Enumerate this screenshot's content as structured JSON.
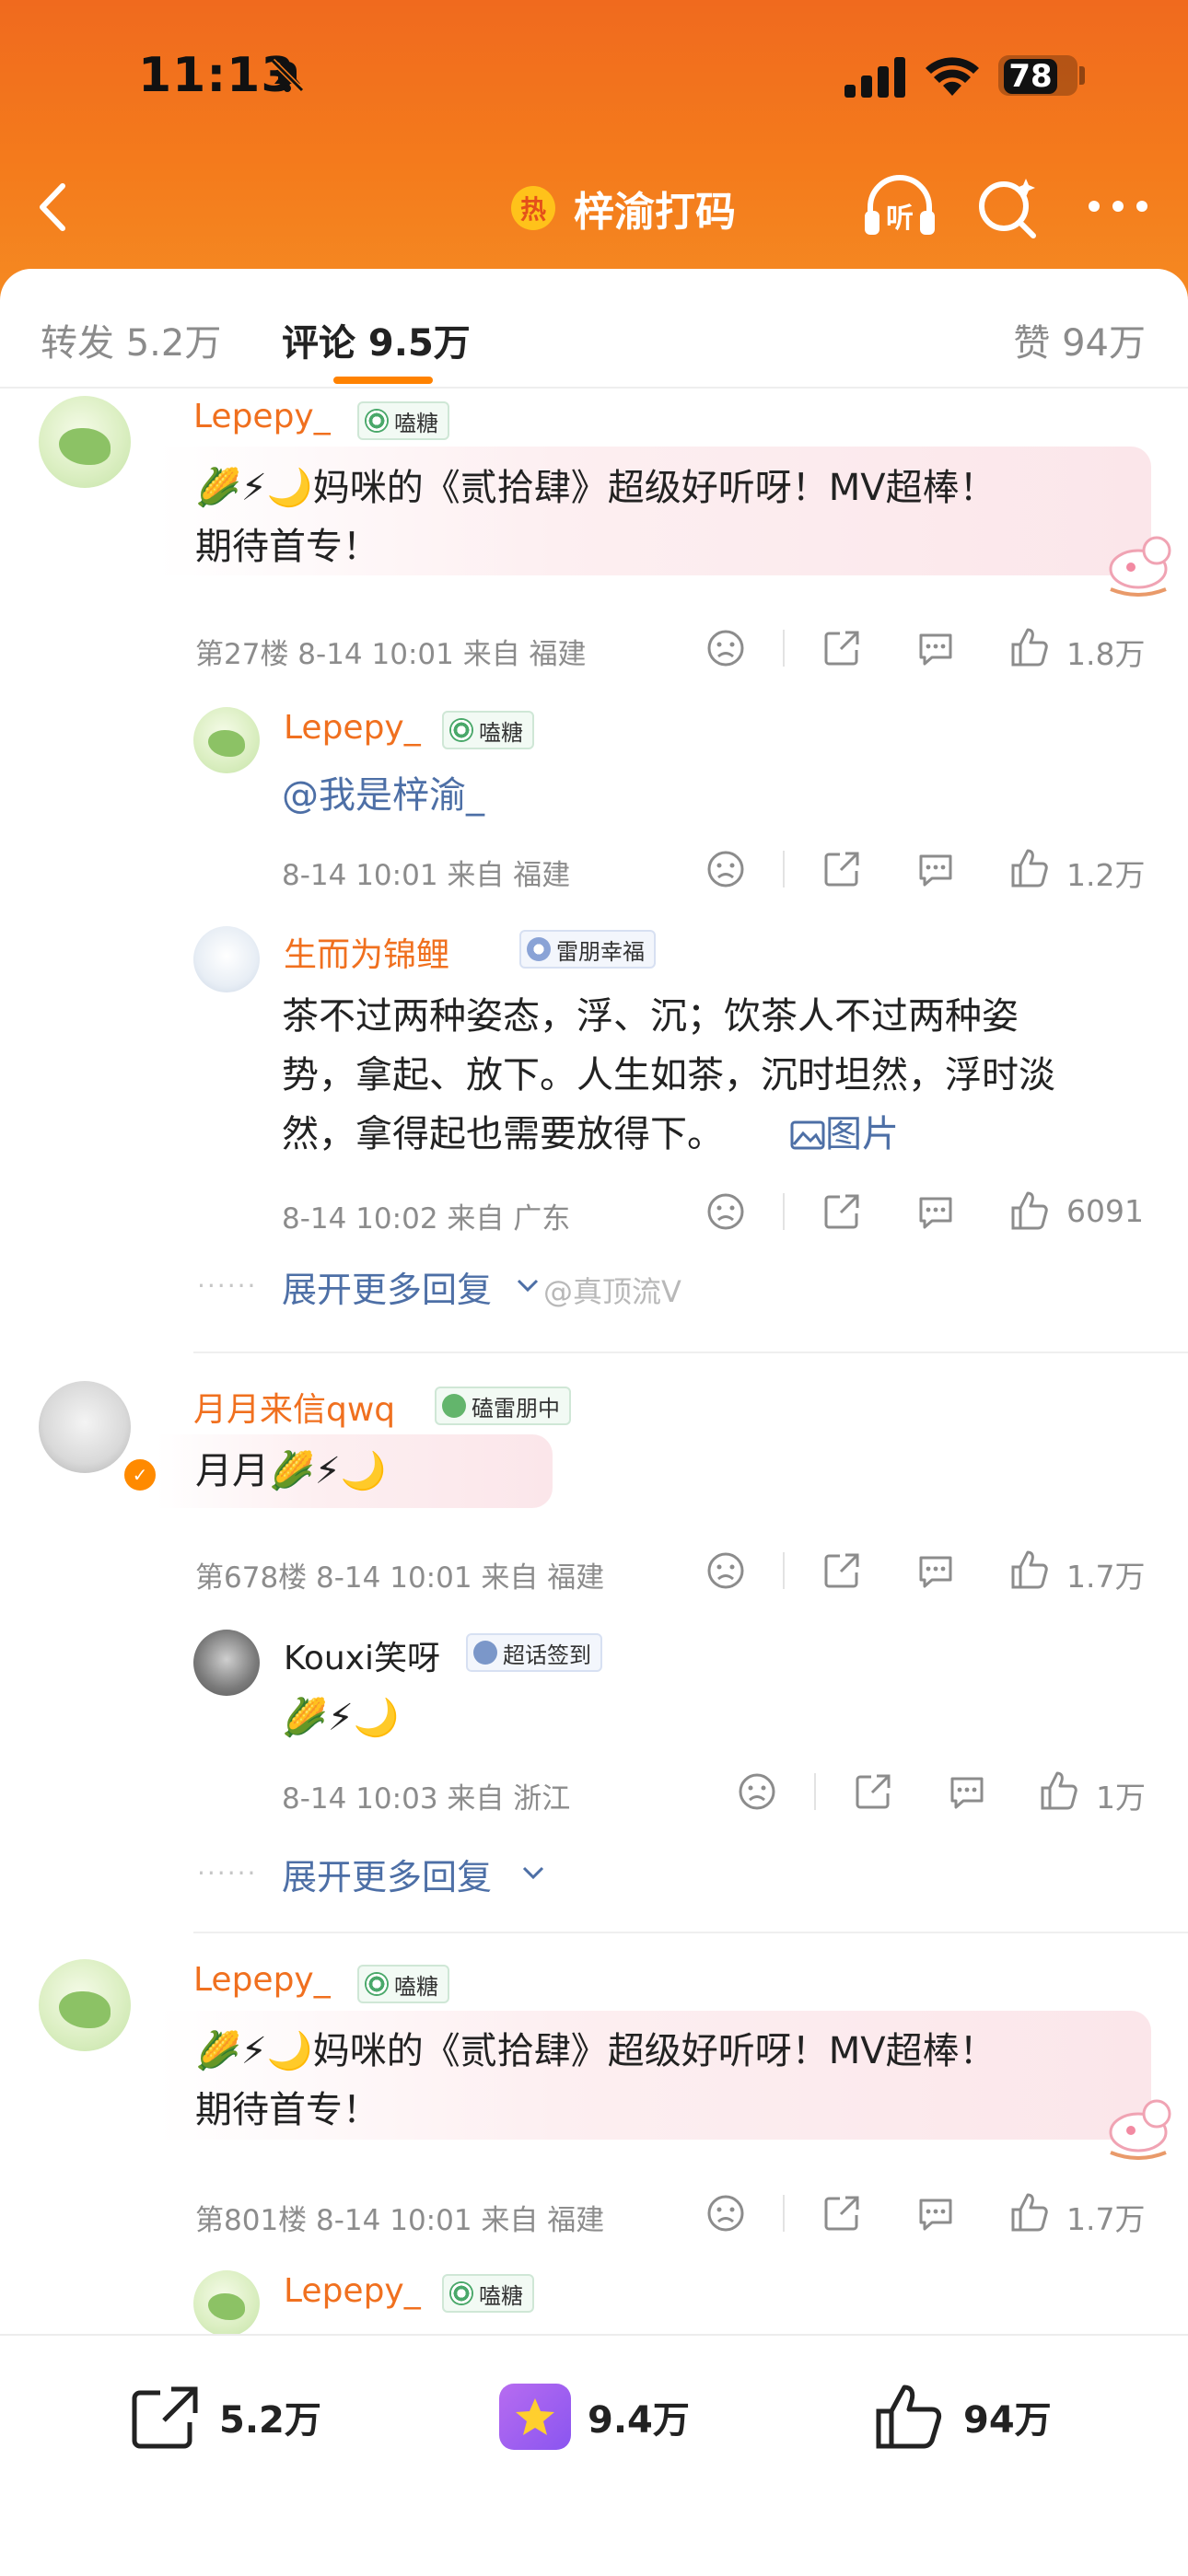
{
  "status_bar": {
    "time": "11:13",
    "battery": "78"
  },
  "header": {
    "title": "梓渝打码",
    "hot_icon": "热"
  },
  "tabs": {
    "repost": "转发 5.2万",
    "comments": "评论 9.5万",
    "likes": "赞 94万"
  },
  "comments": [
    {
      "user": "Lepepy_",
      "badge": "嗑糖",
      "text_line1": "🌽⚡🌙妈咪的《贰拾肆》超级好听呀！MV超棒！",
      "text_line2": "期待首专！",
      "meta": "第27楼 8-14 10:01 来自 福建",
      "likes": "1.8万"
    },
    {
      "user": "Lepepy_",
      "badge": "嗑糖",
      "mention": "@我是梓渝_",
      "meta": "8-14 10:01 来自 福建",
      "likes": "1.2万"
    },
    {
      "user": "生而为锦鲤",
      "badge": "雷朋幸福",
      "text_line1": "茶不过两种姿态，浮、沉；饮茶人不过两种姿",
      "text_line2": "势，拿起、放下。人生如茶，沉时坦然，浮时淡",
      "text_line3": "然，拿得起也需要放得下。",
      "image_link": "图片",
      "meta": "8-14 10:02 来自 广东",
      "likes": "6091"
    },
    {
      "expand": "展开更多回复",
      "watermark": "@真顶流V"
    },
    {
      "user": "月月来信qwq",
      "badge": "磕雷朋中",
      "text": "月月🌽⚡🌙",
      "meta": "第678楼 8-14 10:01 来自 福建",
      "likes": "1.7万"
    },
    {
      "user": "Kouxi笑呀",
      "badge": "超话签到",
      "text": "🌽⚡🌙",
      "meta": "8-14 10:03 来自 浙江",
      "likes": "1万"
    },
    {
      "expand": "展开更多回复"
    },
    {
      "user": "Lepepy_",
      "badge": "嗑糖",
      "text_line1": "🌽⚡🌙妈咪的《贰拾肆》超级好听呀！MV超棒！",
      "text_line2": "期待首专！",
      "meta": "第801楼 8-14 10:01 来自 福建",
      "likes": "1.7万"
    },
    {
      "user": "Lepepy_",
      "badge": "嗑糖"
    }
  ],
  "bottom_bar": {
    "repost": "5.2万",
    "favorite": "9.4万",
    "like": "94万"
  },
  "colors": {
    "header_orange": "#f47b1c",
    "accent": "#ff8200",
    "username": "#f0701f",
    "link": "#4d6fa6"
  }
}
